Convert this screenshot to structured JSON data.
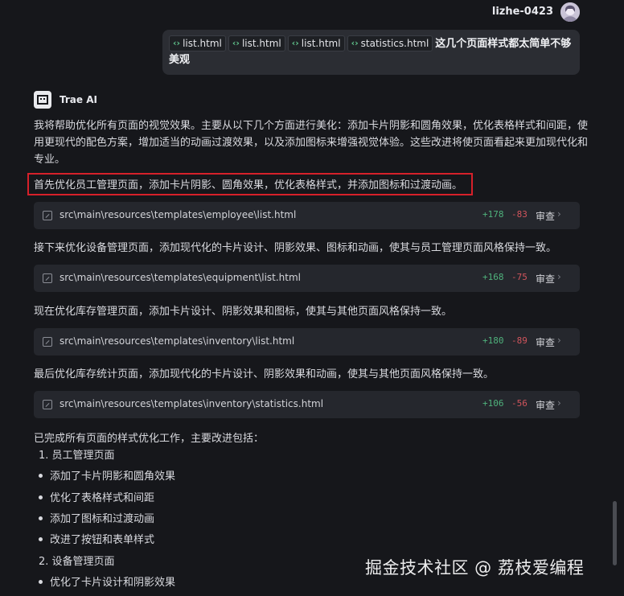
{
  "user": {
    "name": "lizhe-0423",
    "message": {
      "chips": [
        "list.html",
        "list.html",
        "list.html",
        "statistics.html"
      ],
      "text": "这几个页面样式都太简单不够美观"
    }
  },
  "assistant": {
    "name": "Trae AI",
    "intro": "我将帮助优化所有页面的视觉效果。主要从以下几个方面进行美化：添加卡片阴影和圆角效果，优化表格样式和间距，使用更现代的配色方案，增加适当的动画过渡效果，以及添加图标来增强视觉体验。这些改进将使页面看起来更加现代化和专业。",
    "steps": [
      {
        "text": "首先优化员工管理页面，添加卡片阴影、圆角效果，优化表格样式，并添加图标和过渡动画。",
        "file": "src\\main\\resources\\templates\\employee\\list.html",
        "added": "+178",
        "removed": "-83",
        "review": "审查"
      },
      {
        "text": "接下来优化设备管理页面，添加现代化的卡片设计、阴影效果、图标和动画，使其与员工管理页面风格保持一致。",
        "file": "src\\main\\resources\\templates\\equipment\\list.html",
        "added": "+168",
        "removed": "-75",
        "review": "审查"
      },
      {
        "text": "现在优化库存管理页面，添加卡片设计、阴影效果和图标，使其与其他页面风格保持一致。",
        "file": "src\\main\\resources\\templates\\inventory\\list.html",
        "added": "+180",
        "removed": "-89",
        "review": "审查"
      },
      {
        "text": "最后优化库存统计页面，添加现代化的卡片设计、阴影效果和动画，使其与其他页面风格保持一致。",
        "file": "src\\main\\resources\\templates\\inventory\\statistics.html",
        "added": "+106",
        "removed": "-56",
        "review": "审查"
      }
    ],
    "summary": "已完成所有页面的样式优化工作，主要改进包括：",
    "list": {
      "item1": "1. 员工管理页面",
      "bullets1": [
        "添加了卡片阴影和圆角效果",
        "优化了表格样式和间距",
        "添加了图标和过渡动画",
        "改进了按钮和表单样式"
      ],
      "item2": "2. 设备管理页面",
      "bullets2": [
        "优化了卡片设计和阴影效果"
      ]
    }
  },
  "watermark": "掘金技术社区 @ 荔枝爱编程",
  "colors": {
    "background": "#16171b",
    "card": "#25272d",
    "added": "#4fb27c",
    "removed": "#d0545c",
    "highlight": "#d6202a"
  }
}
